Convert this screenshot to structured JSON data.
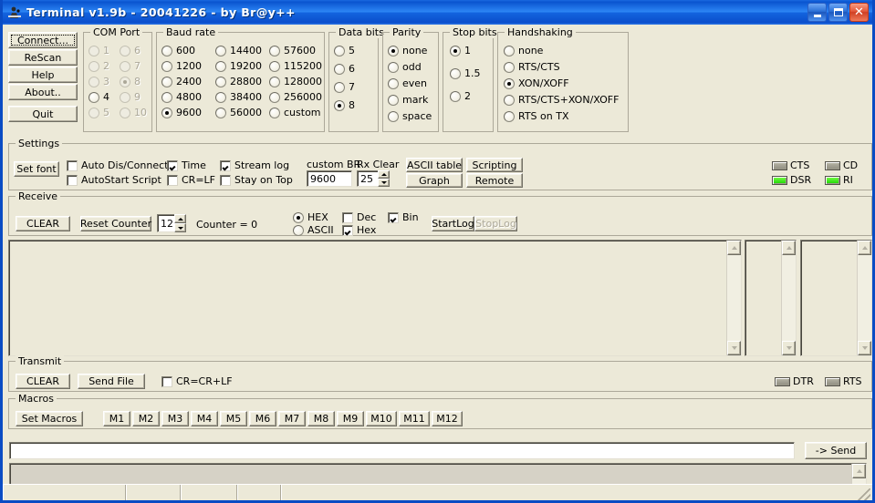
{
  "window": {
    "title": "Terminal v1.9b - 20041226 - by Br@y++",
    "icon": "terminal-icon",
    "minimize": "–",
    "maximize": "□",
    "close": "✕"
  },
  "action_buttons": [
    {
      "label": "Connect...",
      "name": "connect-button",
      "focused": true
    },
    {
      "label": "ReScan",
      "name": "rescan-button",
      "focused": false
    },
    {
      "label": "Help",
      "name": "help-button",
      "focused": false
    },
    {
      "label": "About..",
      "name": "about-button",
      "focused": false
    },
    {
      "label": "Quit",
      "name": "quit-button",
      "focused": false
    }
  ],
  "com_port": {
    "caption": "COM Port",
    "selected": "8",
    "options": [
      {
        "label": "1",
        "selected": false,
        "enabled": false
      },
      {
        "label": "2",
        "selected": false,
        "enabled": false
      },
      {
        "label": "3",
        "selected": false,
        "enabled": false
      },
      {
        "label": "4",
        "selected": false,
        "enabled": true
      },
      {
        "label": "5",
        "selected": false,
        "enabled": false
      },
      {
        "label": "6",
        "selected": false,
        "enabled": false
      },
      {
        "label": "7",
        "selected": false,
        "enabled": false
      },
      {
        "label": "8",
        "selected": true,
        "enabled": false
      },
      {
        "label": "9",
        "selected": false,
        "enabled": false
      },
      {
        "label": "10",
        "selected": false,
        "enabled": false
      }
    ]
  },
  "baud_rate": {
    "caption": "Baud rate",
    "selected": "9600",
    "options": [
      {
        "label": "600",
        "selected": false
      },
      {
        "label": "1200",
        "selected": false
      },
      {
        "label": "2400",
        "selected": false
      },
      {
        "label": "4800",
        "selected": false
      },
      {
        "label": "9600",
        "selected": true
      },
      {
        "label": "14400",
        "selected": false
      },
      {
        "label": "19200",
        "selected": false
      },
      {
        "label": "28800",
        "selected": false
      },
      {
        "label": "38400",
        "selected": false
      },
      {
        "label": "56000",
        "selected": false
      },
      {
        "label": "57600",
        "selected": false
      },
      {
        "label": "115200",
        "selected": false
      },
      {
        "label": "128000",
        "selected": false
      },
      {
        "label": "256000",
        "selected": false
      },
      {
        "label": "custom",
        "selected": false
      }
    ]
  },
  "data_bits": {
    "caption": "Data bits",
    "selected": "8",
    "options": [
      {
        "label": "5",
        "selected": false
      },
      {
        "label": "6",
        "selected": false
      },
      {
        "label": "7",
        "selected": false
      },
      {
        "label": "8",
        "selected": true
      }
    ]
  },
  "parity": {
    "caption": "Parity",
    "selected": "none",
    "options": [
      {
        "label": "none",
        "selected": true
      },
      {
        "label": "odd",
        "selected": false
      },
      {
        "label": "even",
        "selected": false
      },
      {
        "label": "mark",
        "selected": false
      },
      {
        "label": "space",
        "selected": false
      }
    ]
  },
  "stop_bits": {
    "caption": "Stop bits",
    "selected": "1",
    "options": [
      {
        "label": "1",
        "selected": true
      },
      {
        "label": "1.5",
        "selected": false
      },
      {
        "label": "2",
        "selected": false
      }
    ]
  },
  "handshaking": {
    "caption": "Handshaking",
    "selected": "XON/XOFF",
    "options": [
      {
        "label": "none",
        "selected": false
      },
      {
        "label": "RTS/CTS",
        "selected": false
      },
      {
        "label": "XON/XOFF",
        "selected": true
      },
      {
        "label": "RTS/CTS+XON/XOFF",
        "selected": false
      },
      {
        "label": "RTS on TX",
        "selected": false
      }
    ]
  },
  "settings": {
    "caption": "Settings",
    "set_font_label": "Set font",
    "checkboxes": [
      {
        "label": "Auto Dis/Connect",
        "checked": false
      },
      {
        "label": "AutoStart Script",
        "checked": false
      },
      {
        "label": "Time",
        "checked": true
      },
      {
        "label": "CR=LF",
        "checked": false
      },
      {
        "label": "Stream log",
        "checked": true
      },
      {
        "label": "Stay on Top",
        "checked": false
      }
    ],
    "custom_br_label": "custom BR",
    "custom_br_value": "9600",
    "rx_clear_label": "Rx Clear",
    "rx_clear_value": "25",
    "tool_buttons": [
      {
        "label": "ASCII table",
        "name": "ascii-table-button"
      },
      {
        "label": "Scripting",
        "name": "scripting-button"
      },
      {
        "label": "Graph",
        "name": "graph-button"
      },
      {
        "label": "Remote",
        "name": "remote-button"
      }
    ]
  },
  "modem_status": [
    {
      "label": "CTS",
      "on": false
    },
    {
      "label": "CD",
      "on": false
    },
    {
      "label": "DSR",
      "on": true
    },
    {
      "label": "RI",
      "on": true
    }
  ],
  "receive": {
    "caption": "Receive",
    "clear_label": "CLEAR",
    "reset_counter_label": "Reset Counter",
    "counter_field_value": "12",
    "counter_text": "Counter = 0",
    "format_radios": [
      {
        "label": "HEX",
        "selected": true
      },
      {
        "label": "ASCII",
        "selected": false
      }
    ],
    "format_checks": [
      {
        "label": "Dec",
        "checked": false
      },
      {
        "label": "Hex",
        "checked": true
      },
      {
        "label": "Bin",
        "checked": true
      }
    ],
    "start_log_label": "StartLog",
    "stop_log_label": "StopLog",
    "stop_log_disabled": true,
    "content": ""
  },
  "transmit": {
    "caption": "Transmit",
    "clear_label": "CLEAR",
    "send_file_label": "Send File",
    "cr_label": "CR=CR+LF",
    "cr_checked": false,
    "dtr": {
      "label": "DTR",
      "on": false
    },
    "rts": {
      "label": "RTS",
      "on": false
    }
  },
  "macros": {
    "caption": "Macros",
    "set_macros_label": "Set Macros",
    "buttons": [
      "M1",
      "M2",
      "M3",
      "M4",
      "M5",
      "M6",
      "M7",
      "M8",
      "M9",
      "M10",
      "M11",
      "M12"
    ]
  },
  "send_bar": {
    "input_value": "",
    "send_label": "-> Send"
  },
  "status_bar": {
    "cells": [
      "",
      "",
      "",
      "",
      ""
    ]
  },
  "colors": {
    "face": "#ece9d8",
    "titlebar": "#0a54d0",
    "led_on": "#18d400",
    "led_off": "#9a9889"
  }
}
